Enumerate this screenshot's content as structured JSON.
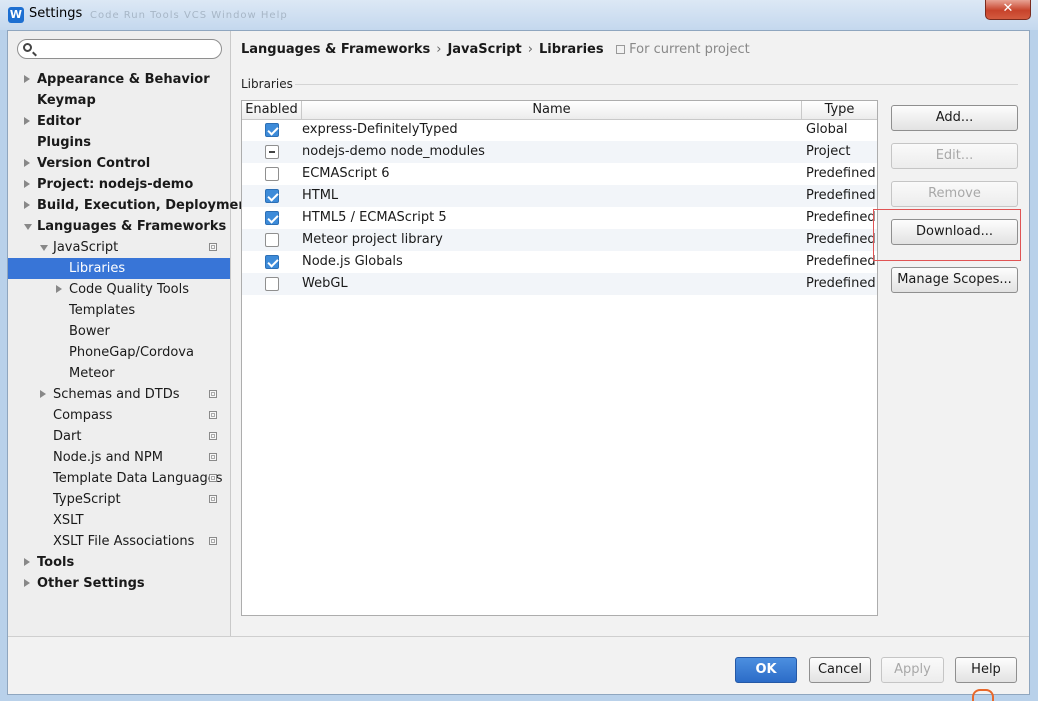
{
  "window": {
    "title": "Settings",
    "app_icon": "W",
    "ghost_menu": "Code  Run  Tools  VCS  Window  Help",
    "close_glyph": "✕"
  },
  "search": {
    "placeholder": "",
    "value": ""
  },
  "tree": [
    {
      "label": "Appearance & Behavior",
      "level": 0,
      "bold": true,
      "arrow": "right"
    },
    {
      "label": "Keymap",
      "level": 0,
      "bold": true
    },
    {
      "label": "Editor",
      "level": 0,
      "bold": true,
      "arrow": "right"
    },
    {
      "label": "Plugins",
      "level": 0,
      "bold": true
    },
    {
      "label": "Version Control",
      "level": 0,
      "bold": true,
      "arrow": "right"
    },
    {
      "label": "Project: nodejs-demo",
      "level": 0,
      "bold": true,
      "arrow": "right"
    },
    {
      "label": "Build, Execution, Deployment",
      "level": 0,
      "bold": true,
      "arrow": "right"
    },
    {
      "label": "Languages & Frameworks",
      "level": 0,
      "bold": true,
      "arrow": "down"
    },
    {
      "label": "JavaScript",
      "level": 1,
      "arrow": "down",
      "project_icon": true
    },
    {
      "label": "Libraries",
      "level": 2,
      "selected": true
    },
    {
      "label": "Code Quality Tools",
      "level": 2,
      "arrow": "right"
    },
    {
      "label": "Templates",
      "level": 2
    },
    {
      "label": "Bower",
      "level": 2
    },
    {
      "label": "PhoneGap/Cordova",
      "level": 2
    },
    {
      "label": "Meteor",
      "level": 2
    },
    {
      "label": "Schemas and DTDs",
      "level": 1,
      "arrow": "right",
      "project_icon": true
    },
    {
      "label": "Compass",
      "level": 1,
      "project_icon": true
    },
    {
      "label": "Dart",
      "level": 1,
      "project_icon": true
    },
    {
      "label": "Node.js and NPM",
      "level": 1,
      "project_icon": true
    },
    {
      "label": "Template Data Languages",
      "level": 1,
      "project_icon": true
    },
    {
      "label": "TypeScript",
      "level": 1,
      "project_icon": true
    },
    {
      "label": "XSLT",
      "level": 1
    },
    {
      "label": "XSLT File Associations",
      "level": 1,
      "project_icon": true
    },
    {
      "label": "Tools",
      "level": 0,
      "bold": true,
      "arrow": "right"
    },
    {
      "label": "Other Settings",
      "level": 0,
      "bold": true,
      "arrow": "right"
    }
  ],
  "breadcrumb": {
    "parts": [
      "Languages & Frameworks",
      "JavaScript",
      "Libraries"
    ],
    "separator": "›",
    "scope_note": "For current project"
  },
  "section_label": "Libraries",
  "table": {
    "columns": [
      "Enabled",
      "Name",
      "Type"
    ],
    "rows": [
      {
        "state": "checked",
        "name": "express-DefinitelyTyped",
        "type": "Global"
      },
      {
        "state": "mixed",
        "name": "nodejs-demo node_modules",
        "type": "Project"
      },
      {
        "state": "unchecked",
        "name": "ECMAScript 6",
        "type": "Predefined"
      },
      {
        "state": "checked",
        "name": "HTML",
        "type": "Predefined"
      },
      {
        "state": "checked",
        "name": "HTML5 / ECMAScript 5",
        "type": "Predefined"
      },
      {
        "state": "unchecked",
        "name": "Meteor project library",
        "type": "Predefined"
      },
      {
        "state": "checked",
        "name": "Node.js Globals",
        "type": "Predefined"
      },
      {
        "state": "unchecked",
        "name": "WebGL",
        "type": "Predefined"
      }
    ]
  },
  "side_buttons": {
    "add": "Add...",
    "edit": "Edit...",
    "remove": "Remove",
    "download": "Download...",
    "manage_scopes": "Manage Scopes..."
  },
  "footer_buttons": {
    "ok": "OK",
    "cancel": "Cancel",
    "apply": "Apply",
    "help": "Help"
  },
  "colors": {
    "selection": "#3875d7",
    "primary_button": "#2c6cc8",
    "highlight_outline": "#e05454"
  }
}
